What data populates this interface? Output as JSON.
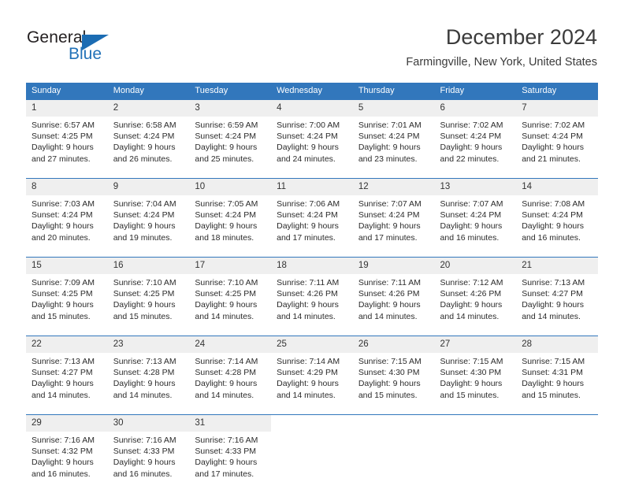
{
  "brand": {
    "name_top": "General",
    "name_bottom": "Blue",
    "accent_color": "#2272b8"
  },
  "header": {
    "title": "December 2024",
    "subtitle": "Farmingville, New York, United States"
  },
  "calendar": {
    "header_bg": "#3277bc",
    "daynum_bg": "#efefef",
    "weekday_headers": [
      "Sunday",
      "Monday",
      "Tuesday",
      "Wednesday",
      "Thursday",
      "Friday",
      "Saturday"
    ],
    "weeks": [
      [
        {
          "day": "1",
          "sunrise": "Sunrise: 6:57 AM",
          "sunset": "Sunset: 4:25 PM",
          "daylight1": "Daylight: 9 hours",
          "daylight2": "and 27 minutes."
        },
        {
          "day": "2",
          "sunrise": "Sunrise: 6:58 AM",
          "sunset": "Sunset: 4:24 PM",
          "daylight1": "Daylight: 9 hours",
          "daylight2": "and 26 minutes."
        },
        {
          "day": "3",
          "sunrise": "Sunrise: 6:59 AM",
          "sunset": "Sunset: 4:24 PM",
          "daylight1": "Daylight: 9 hours",
          "daylight2": "and 25 minutes."
        },
        {
          "day": "4",
          "sunrise": "Sunrise: 7:00 AM",
          "sunset": "Sunset: 4:24 PM",
          "daylight1": "Daylight: 9 hours",
          "daylight2": "and 24 minutes."
        },
        {
          "day": "5",
          "sunrise": "Sunrise: 7:01 AM",
          "sunset": "Sunset: 4:24 PM",
          "daylight1": "Daylight: 9 hours",
          "daylight2": "and 23 minutes."
        },
        {
          "day": "6",
          "sunrise": "Sunrise: 7:02 AM",
          "sunset": "Sunset: 4:24 PM",
          "daylight1": "Daylight: 9 hours",
          "daylight2": "and 22 minutes."
        },
        {
          "day": "7",
          "sunrise": "Sunrise: 7:02 AM",
          "sunset": "Sunset: 4:24 PM",
          "daylight1": "Daylight: 9 hours",
          "daylight2": "and 21 minutes."
        }
      ],
      [
        {
          "day": "8",
          "sunrise": "Sunrise: 7:03 AM",
          "sunset": "Sunset: 4:24 PM",
          "daylight1": "Daylight: 9 hours",
          "daylight2": "and 20 minutes."
        },
        {
          "day": "9",
          "sunrise": "Sunrise: 7:04 AM",
          "sunset": "Sunset: 4:24 PM",
          "daylight1": "Daylight: 9 hours",
          "daylight2": "and 19 minutes."
        },
        {
          "day": "10",
          "sunrise": "Sunrise: 7:05 AM",
          "sunset": "Sunset: 4:24 PM",
          "daylight1": "Daylight: 9 hours",
          "daylight2": "and 18 minutes."
        },
        {
          "day": "11",
          "sunrise": "Sunrise: 7:06 AM",
          "sunset": "Sunset: 4:24 PM",
          "daylight1": "Daylight: 9 hours",
          "daylight2": "and 17 minutes."
        },
        {
          "day": "12",
          "sunrise": "Sunrise: 7:07 AM",
          "sunset": "Sunset: 4:24 PM",
          "daylight1": "Daylight: 9 hours",
          "daylight2": "and 17 minutes."
        },
        {
          "day": "13",
          "sunrise": "Sunrise: 7:07 AM",
          "sunset": "Sunset: 4:24 PM",
          "daylight1": "Daylight: 9 hours",
          "daylight2": "and 16 minutes."
        },
        {
          "day": "14",
          "sunrise": "Sunrise: 7:08 AM",
          "sunset": "Sunset: 4:24 PM",
          "daylight1": "Daylight: 9 hours",
          "daylight2": "and 16 minutes."
        }
      ],
      [
        {
          "day": "15",
          "sunrise": "Sunrise: 7:09 AM",
          "sunset": "Sunset: 4:25 PM",
          "daylight1": "Daylight: 9 hours",
          "daylight2": "and 15 minutes."
        },
        {
          "day": "16",
          "sunrise": "Sunrise: 7:10 AM",
          "sunset": "Sunset: 4:25 PM",
          "daylight1": "Daylight: 9 hours",
          "daylight2": "and 15 minutes."
        },
        {
          "day": "17",
          "sunrise": "Sunrise: 7:10 AM",
          "sunset": "Sunset: 4:25 PM",
          "daylight1": "Daylight: 9 hours",
          "daylight2": "and 14 minutes."
        },
        {
          "day": "18",
          "sunrise": "Sunrise: 7:11 AM",
          "sunset": "Sunset: 4:26 PM",
          "daylight1": "Daylight: 9 hours",
          "daylight2": "and 14 minutes."
        },
        {
          "day": "19",
          "sunrise": "Sunrise: 7:11 AM",
          "sunset": "Sunset: 4:26 PM",
          "daylight1": "Daylight: 9 hours",
          "daylight2": "and 14 minutes."
        },
        {
          "day": "20",
          "sunrise": "Sunrise: 7:12 AM",
          "sunset": "Sunset: 4:26 PM",
          "daylight1": "Daylight: 9 hours",
          "daylight2": "and 14 minutes."
        },
        {
          "day": "21",
          "sunrise": "Sunrise: 7:13 AM",
          "sunset": "Sunset: 4:27 PM",
          "daylight1": "Daylight: 9 hours",
          "daylight2": "and 14 minutes."
        }
      ],
      [
        {
          "day": "22",
          "sunrise": "Sunrise: 7:13 AM",
          "sunset": "Sunset: 4:27 PM",
          "daylight1": "Daylight: 9 hours",
          "daylight2": "and 14 minutes."
        },
        {
          "day": "23",
          "sunrise": "Sunrise: 7:13 AM",
          "sunset": "Sunset: 4:28 PM",
          "daylight1": "Daylight: 9 hours",
          "daylight2": "and 14 minutes."
        },
        {
          "day": "24",
          "sunrise": "Sunrise: 7:14 AM",
          "sunset": "Sunset: 4:28 PM",
          "daylight1": "Daylight: 9 hours",
          "daylight2": "and 14 minutes."
        },
        {
          "day": "25",
          "sunrise": "Sunrise: 7:14 AM",
          "sunset": "Sunset: 4:29 PM",
          "daylight1": "Daylight: 9 hours",
          "daylight2": "and 14 minutes."
        },
        {
          "day": "26",
          "sunrise": "Sunrise: 7:15 AM",
          "sunset": "Sunset: 4:30 PM",
          "daylight1": "Daylight: 9 hours",
          "daylight2": "and 15 minutes."
        },
        {
          "day": "27",
          "sunrise": "Sunrise: 7:15 AM",
          "sunset": "Sunset: 4:30 PM",
          "daylight1": "Daylight: 9 hours",
          "daylight2": "and 15 minutes."
        },
        {
          "day": "28",
          "sunrise": "Sunrise: 7:15 AM",
          "sunset": "Sunset: 4:31 PM",
          "daylight1": "Daylight: 9 hours",
          "daylight2": "and 15 minutes."
        }
      ],
      [
        {
          "day": "29",
          "sunrise": "Sunrise: 7:16 AM",
          "sunset": "Sunset: 4:32 PM",
          "daylight1": "Daylight: 9 hours",
          "daylight2": "and 16 minutes."
        },
        {
          "day": "30",
          "sunrise": "Sunrise: 7:16 AM",
          "sunset": "Sunset: 4:33 PM",
          "daylight1": "Daylight: 9 hours",
          "daylight2": "and 16 minutes."
        },
        {
          "day": "31",
          "sunrise": "Sunrise: 7:16 AM",
          "sunset": "Sunset: 4:33 PM",
          "daylight1": "Daylight: 9 hours",
          "daylight2": "and 17 minutes."
        },
        {
          "day": "",
          "sunrise": "",
          "sunset": "",
          "daylight1": "",
          "daylight2": ""
        },
        {
          "day": "",
          "sunrise": "",
          "sunset": "",
          "daylight1": "",
          "daylight2": ""
        },
        {
          "day": "",
          "sunrise": "",
          "sunset": "",
          "daylight1": "",
          "daylight2": ""
        },
        {
          "day": "",
          "sunrise": "",
          "sunset": "",
          "daylight1": "",
          "daylight2": ""
        }
      ]
    ]
  }
}
